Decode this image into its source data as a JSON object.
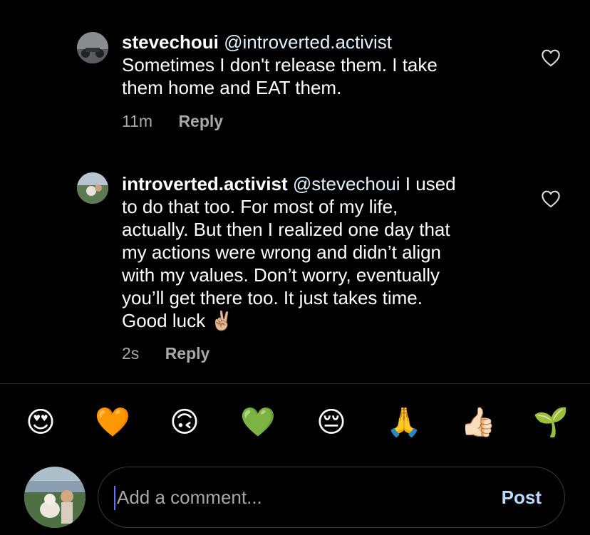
{
  "comments": [
    {
      "username": "stevechoui",
      "mention": "@introverted.activist",
      "text": "Sometimes I don't release them. I take\nthem home and EAT them.",
      "time": "11m",
      "reply": "Reply"
    },
    {
      "username": "introverted.activist",
      "mention": "@stevechoui",
      "text": " I used\nto do that too. For most of my life,\nactually. But then I realized one day that\nmy actions were wrong and didn’t align\nwith my values. Don’t worry, eventually\nyou’ll get there too. It just takes time.\nGood luck ✌🏼",
      "time": "2s",
      "reply": "Reply"
    }
  ],
  "emoji_bar": [
    "😍",
    "🧡",
    "🙃",
    "💚",
    "😔",
    "🙏",
    "👍🏻",
    "🌱"
  ],
  "composer": {
    "placeholder": "Add a comment...",
    "post_label": "Post"
  },
  "colors": {
    "background": "#000000",
    "meta_gray": "#a8a8a8",
    "post_blue": "#b5dbff"
  }
}
